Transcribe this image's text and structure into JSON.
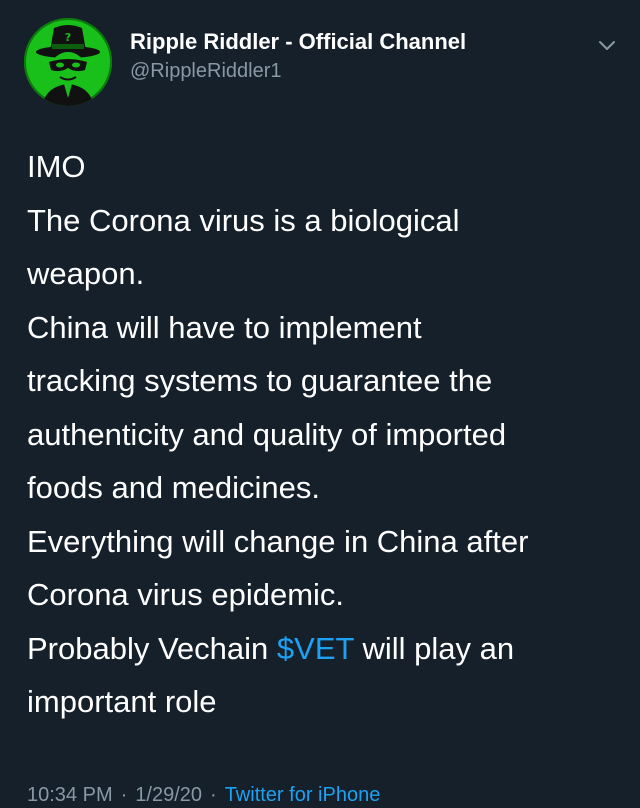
{
  "author": {
    "display_name": "Ripple Riddler - Official Channel",
    "handle": "@RippleRiddler1",
    "avatar_icon": "riddler-hat-mask-icon",
    "avatar_color": "#19c019"
  },
  "tweet": {
    "line1": "IMO",
    "line2": "The Corona virus is a biological",
    "line3": "weapon.",
    "line4": "China will have to implement",
    "line5": "tracking systems to guarantee the",
    "line6": "authenticity and quality of imported",
    "line7": "foods and medicines.",
    "line8": "Everything will change in China after",
    "line9": "Corona virus epidemic.",
    "line10_prefix": "Probably Vechain ",
    "cashtag": "$VET",
    "line10_suffix": " will play an",
    "line11": "important role"
  },
  "meta": {
    "time": "10:34 PM",
    "separator": "·",
    "date": "1/29/20",
    "source": "Twitter for iPhone"
  },
  "colors": {
    "background": "#15202b",
    "text": "#ffffff",
    "secondary": "#8899a6",
    "link": "#1da1f2"
  },
  "icons": {
    "menu": "chevron-down-icon"
  }
}
